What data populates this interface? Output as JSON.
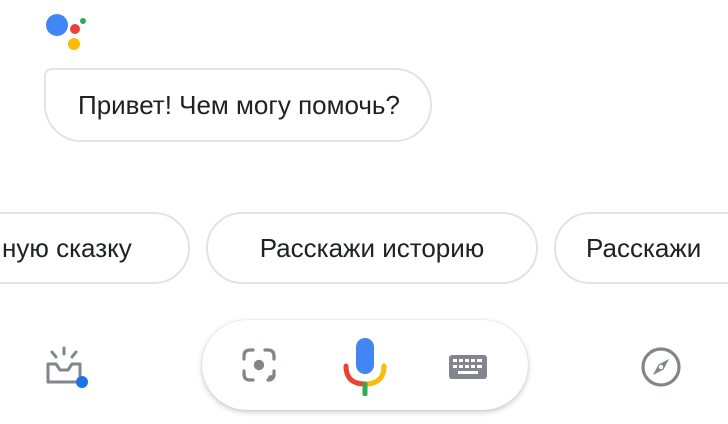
{
  "greeting": {
    "text": "Привет! Чем могу помочь?"
  },
  "suggestions": [
    {
      "label": "ную сказку"
    },
    {
      "label": "Расскажи историю"
    },
    {
      "label": "Расскажи"
    }
  ],
  "bottom_bar": {
    "left_icon": "inbox-updates-icon",
    "center_icons": [
      "lens-icon",
      "mic-icon",
      "keyboard-icon"
    ],
    "right_icon": "compass-icon"
  },
  "colors": {
    "google_blue": "#4285F4",
    "google_red": "#EA4335",
    "google_yellow": "#FBBC05",
    "google_green": "#34A853",
    "icon_gray": "#80868b"
  }
}
